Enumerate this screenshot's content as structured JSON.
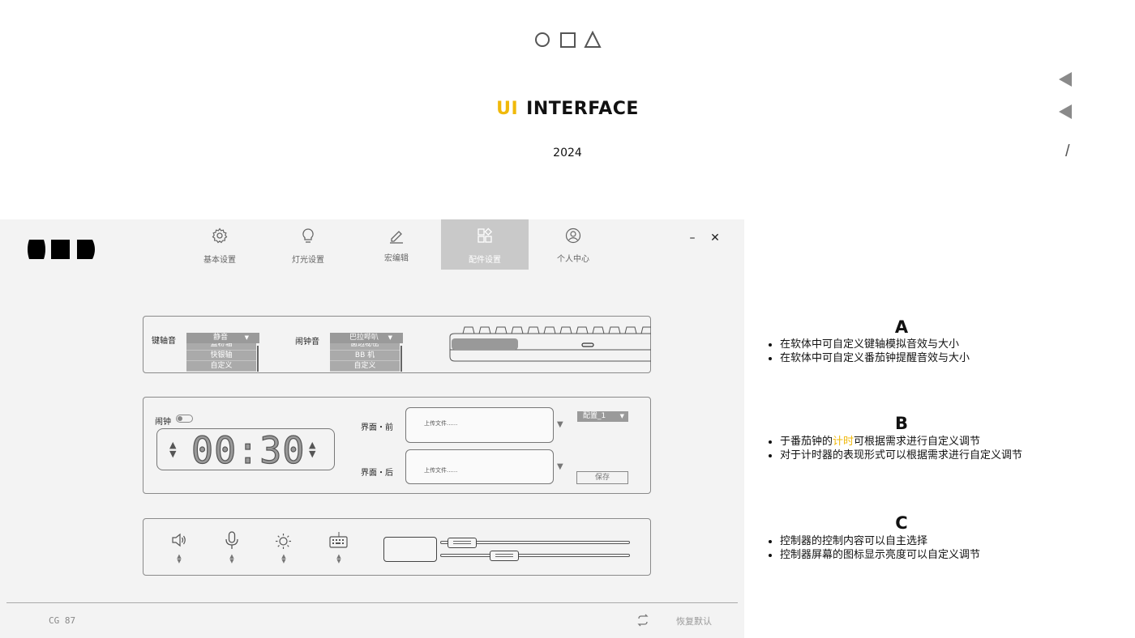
{
  "header": {
    "shape_icons": [
      "circle-icon",
      "square-icon",
      "triangle-icon"
    ],
    "title_accent": "UI",
    "title_main": "INTERFACE",
    "year": "2024",
    "side_marks": [
      "left-triangle-icon",
      "left-triangle-icon"
    ],
    "slash": "/"
  },
  "app": {
    "nav": [
      {
        "label": "基本设置",
        "icon": "gear-icon"
      },
      {
        "label": "灯光设置",
        "icon": "lightbulb-icon"
      },
      {
        "label": "宏编辑",
        "icon": "edit-icon"
      },
      {
        "label": "配件设置",
        "icon": "accessories-icon",
        "active": true
      },
      {
        "label": "个人中心",
        "icon": "user-icon"
      }
    ],
    "window": {
      "minimize": "–",
      "close": "✕"
    },
    "sound": {
      "switch_label": "键轴音",
      "switch_selected": "静音",
      "switch_options": [
        "蓝粉轴",
        "快银轴",
        "自定义"
      ],
      "alarm_label": "闹钟音",
      "alarm_selected": "巴拉哔叭",
      "alarm_options": [
        "窗边秘密",
        "BB 机",
        "自定义"
      ]
    },
    "timer": {
      "alarm_toggle_label": "闹钟",
      "time": "00:30",
      "front_label": "界面・前",
      "back_label": "界面・后",
      "upload_placeholder": "上传文件......",
      "config_selected": "配置_1",
      "save_label": "保存"
    },
    "controller": {
      "icons": [
        "speaker-icon",
        "microphone-icon",
        "brightness-icon",
        "keyboard-icon"
      ],
      "stepper": "▲\n▼"
    },
    "footer": {
      "model": "CG 87",
      "reset_label": "恢复默认"
    }
  },
  "notes": {
    "A": {
      "letter": "A",
      "items": [
        "在软体中可自定义键轴模拟音效与大小",
        "在软体中可自定义番茄钟提醒音效与大小"
      ]
    },
    "B": {
      "letter": "B",
      "item1_pre": "于番茄钟的",
      "item1_highlight": "计时",
      "item1_post": "可根据需求进行自定义调节",
      "item2": "对于计时器的表现形式可以根据需求进行自定义调节"
    },
    "C": {
      "letter": "C",
      "items": [
        "控制器的控制内容可以自主选择",
        "控制器屏幕的图标显示亮度可以自定义调节"
      ]
    }
  },
  "colors": {
    "accent": "#f0b90b",
    "active_tab": "#c9c9c9",
    "panel_bg": "#f3f3f3"
  }
}
